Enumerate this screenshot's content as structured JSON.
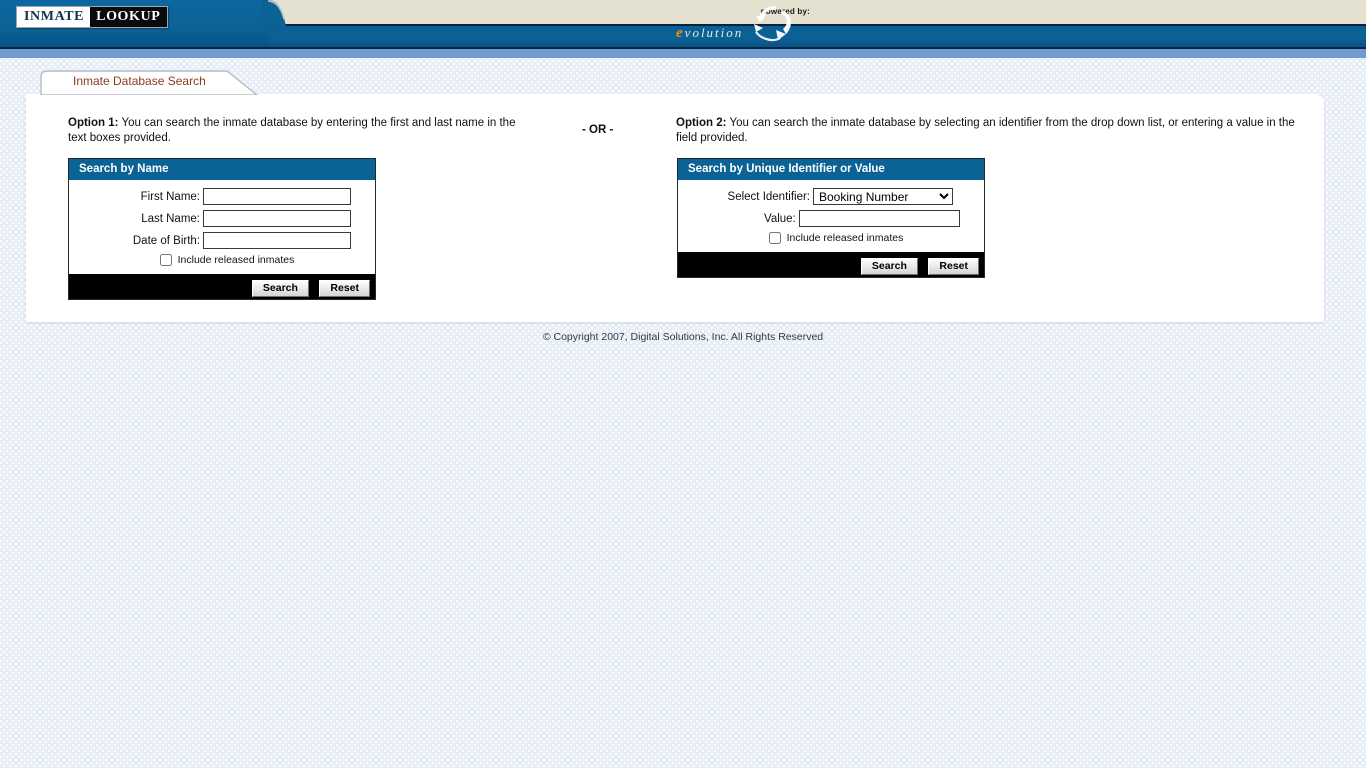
{
  "header": {
    "logo_primary": "INMATE",
    "logo_secondary": "LOOKUP",
    "powered_by_label": "powered by:",
    "powered_by_brand_initial": "e",
    "powered_by_brand_rest": "volution",
    "brand_accent_color": "#e8920c",
    "bar_color": "#0b6295",
    "beige_color": "#e5e1d0"
  },
  "tab": {
    "label": "Inmate Database Search",
    "label_color": "#8c3b1e"
  },
  "options": {
    "option1_bold": "Option 1:",
    "option1_text": " You can search the inmate database by entering the first and last name in the text boxes provided.",
    "option2_bold": "Option 2:",
    "option2_text": " You can search the inmate database by selecting an identifier from the drop down list, or entering a value in the field provided.",
    "or_divider": "- OR -"
  },
  "search_by_name": {
    "title": "Search by Name",
    "fields": [
      {
        "label": "First Name:",
        "value": "",
        "placeholder": ""
      },
      {
        "label": "Last Name:",
        "value": "",
        "placeholder": ""
      },
      {
        "label": "Date of Birth:",
        "value": "",
        "placeholder": ""
      }
    ],
    "checkbox_label": "Include released inmates",
    "checkbox_checked": false,
    "search_button": "Search",
    "reset_button": "Reset"
  },
  "search_by_identifier": {
    "title": "Search by Unique Identifier or Value",
    "select_label": "Select Identifier:",
    "select_value": "Booking Number",
    "select_options": [
      "Booking Number"
    ],
    "value_label": "Value:",
    "value_value": "",
    "checkbox_label": "Include released inmates",
    "checkbox_checked": false,
    "search_button": "Search",
    "reset_button": "Reset"
  },
  "footer": {
    "copyright": "© Copyright 2007, Digital Solutions, Inc. All Rights Reserved"
  }
}
